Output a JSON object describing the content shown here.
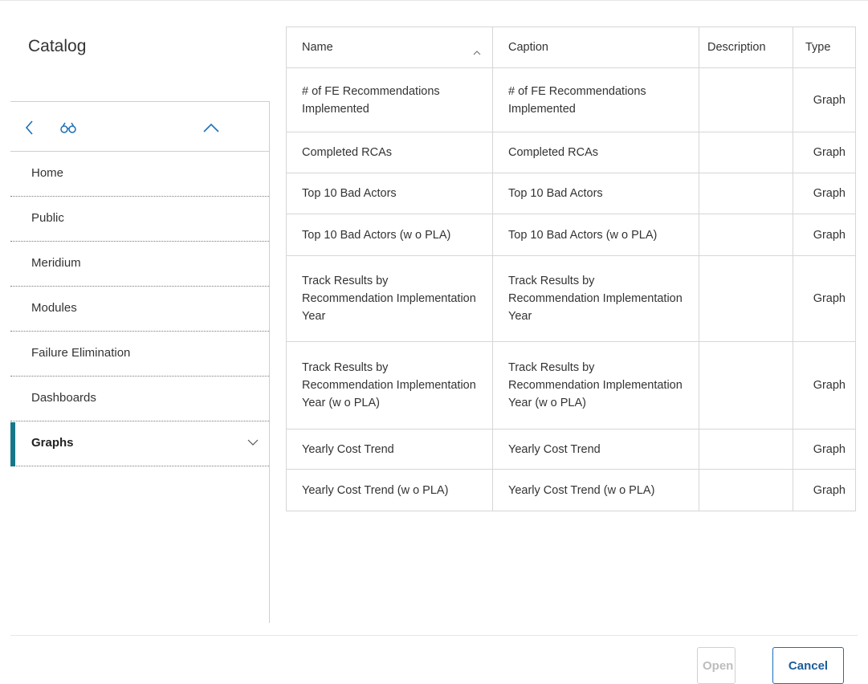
{
  "catalog": {
    "title": "Catalog"
  },
  "nav": {
    "items": [
      {
        "label": "Home"
      },
      {
        "label": "Public"
      },
      {
        "label": "Meridium"
      },
      {
        "label": "Modules"
      },
      {
        "label": "Failure Elimination"
      },
      {
        "label": "Dashboards"
      },
      {
        "label": "Graphs",
        "active": true
      }
    ]
  },
  "table": {
    "columns": [
      "Name",
      "Caption",
      "Description",
      "Type"
    ],
    "sort": {
      "column": "Name",
      "direction": "ascending"
    },
    "rows": [
      {
        "name": "# of FE Recommendations Implemented",
        "caption": "# of FE Recommendations Implemented",
        "description": "",
        "type": "Graph"
      },
      {
        "name": "Completed RCAs",
        "caption": "Completed RCAs",
        "description": "",
        "type": "Graph"
      },
      {
        "name": "Top 10 Bad Actors",
        "caption": "Top 10 Bad Actors",
        "description": "",
        "type": "Graph"
      },
      {
        "name": "Top 10 Bad Actors (w o PLA)",
        "caption": "Top 10 Bad Actors (w o PLA)",
        "description": "",
        "type": "Graph"
      },
      {
        "name": "Track Results by Recommendation Implementation Year",
        "caption": "Track Results by Recommendation Implementation Year",
        "description": "",
        "type": "Graph"
      },
      {
        "name": "Track Results by Recommendation Implementation Year (w o PLA)",
        "caption": "Track Results by Recommendation Implementation Year (w o PLA)",
        "description": "",
        "type": "Graph"
      },
      {
        "name": "Yearly Cost Trend",
        "caption": "Yearly Cost Trend",
        "description": "",
        "type": "Graph"
      },
      {
        "name": "Yearly Cost Trend (w o PLA)",
        "caption": "Yearly Cost Trend (w o PLA)",
        "description": "",
        "type": "Graph"
      }
    ]
  },
  "footer": {
    "open_label": "Open",
    "cancel_label": "Cancel"
  },
  "colors": {
    "active_accent": "#17778a",
    "nav_icon": "#1a6fb8",
    "primary_button": "#1a6fb8"
  },
  "icons": {
    "back": "chevron-left-icon",
    "find": "binoculars-icon",
    "collapse": "chevron-up-icon",
    "expand": "chevron-down-icon",
    "sort": "sort-ascending-icon"
  }
}
